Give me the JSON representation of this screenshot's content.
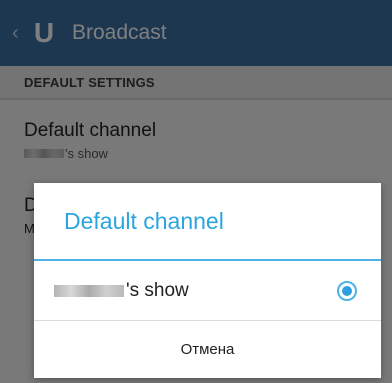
{
  "actionbar": {
    "back_icon": "chevron-left-icon",
    "logo_letter": "U",
    "title": "Broadcast"
  },
  "settings": {
    "section_header": "DEFAULT SETTINGS",
    "items": [
      {
        "title": "Default channel",
        "summary_suffix": "'s show"
      },
      {
        "title_initial": "D",
        "summary_initial": "M"
      }
    ]
  },
  "dialog": {
    "title": "Default channel",
    "options": [
      {
        "label_suffix": "'s show",
        "selected": true
      }
    ],
    "cancel_label": "Отмена"
  },
  "colors": {
    "actionbar_bg": "#3d6fa3",
    "accent": "#2aa5e0"
  }
}
